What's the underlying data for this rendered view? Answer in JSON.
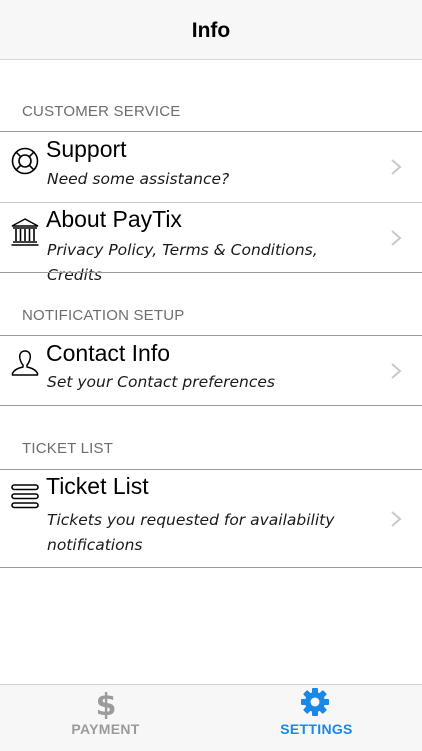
{
  "navbar": {
    "title": "Info"
  },
  "sections": {
    "customer_service": {
      "header": "CUSTOMER SERVICE",
      "support": {
        "title": "Support",
        "subtitle": "Need some assistance?"
      },
      "about": {
        "title": "About PayTix",
        "subtitle": "Privacy Policy, Terms & Conditions, Credits"
      }
    },
    "notification_setup": {
      "header": "NOTIFICATION SETUP",
      "contact": {
        "title": "Contact Info",
        "subtitle": "Set your Contact preferences"
      }
    },
    "ticket_list": {
      "header": "TICKET LIST",
      "tickets": {
        "title": "Ticket List",
        "subtitle": "Tickets you requested for availability notifications"
      }
    }
  },
  "tabbar": {
    "payment": {
      "label": "PAYMENT",
      "icon": "dollar-icon",
      "color": "#9b9b9b"
    },
    "settings": {
      "label": "SETTINGS",
      "icon": "gear-icon",
      "color": "#1a88e6"
    }
  }
}
